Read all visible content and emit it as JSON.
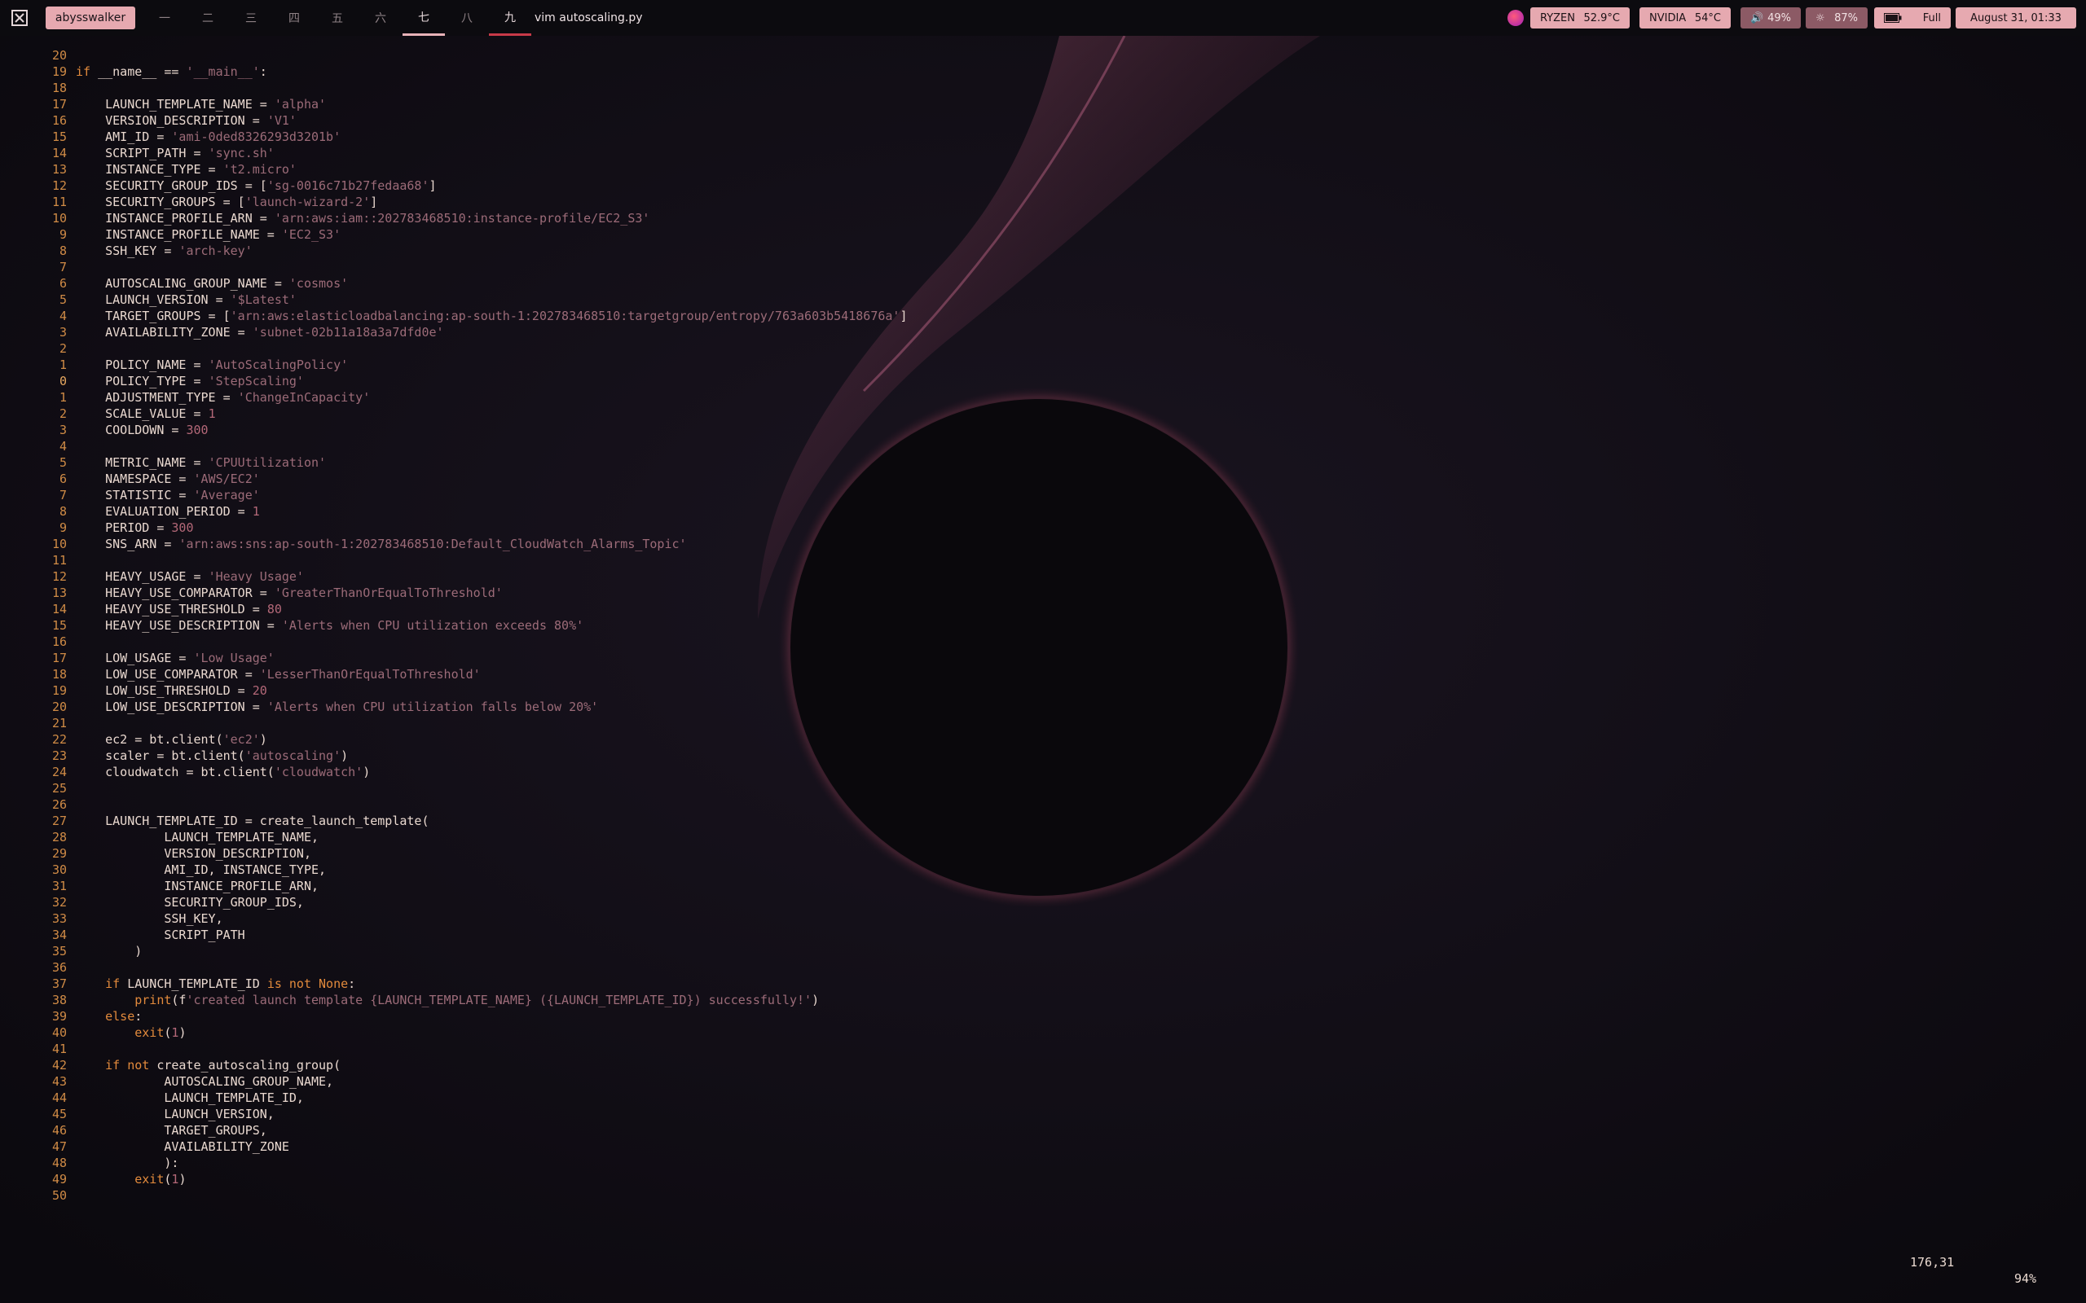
{
  "topbar": {
    "user": "abysswalker",
    "workspaces": [
      {
        "label": "一",
        "state": "normal"
      },
      {
        "label": "二",
        "state": "normal"
      },
      {
        "label": "三",
        "state": "normal"
      },
      {
        "label": "四",
        "state": "normal"
      },
      {
        "label": "五",
        "state": "normal"
      },
      {
        "label": "六",
        "state": "normal"
      },
      {
        "label": "七",
        "state": "active"
      },
      {
        "label": "八",
        "state": "normal"
      },
      {
        "label": "九",
        "state": "urgent"
      }
    ],
    "window_title": "vim autoscaling.py",
    "cpu": {
      "name": "RYZEN",
      "temp": "52.9°C"
    },
    "gpu": {
      "name": "NVIDIA",
      "temp": "54°C"
    },
    "volume": "49%",
    "brightness": "87%",
    "battery": "Full",
    "datetime": "August 31, 01:33",
    "colors": {
      "accent": "#e6a9b0",
      "dim_pill": "#8c5a65",
      "active_underline": "#e8b2b8",
      "urgent_underline": "#c83a48"
    }
  },
  "editor": {
    "lines": [
      {
        "n": "20",
        "t": [
          [
            "plain",
            ""
          ]
        ]
      },
      {
        "n": "19",
        "t": [
          [
            "kw",
            "if"
          ],
          [
            "plain",
            " __name__ == "
          ],
          [
            "str",
            "'__main__'"
          ],
          [
            "plain",
            ":"
          ]
        ]
      },
      {
        "n": "18",
        "t": [
          [
            "plain",
            ""
          ]
        ]
      },
      {
        "n": "17",
        "t": [
          [
            "plain",
            "    LAUNCH_TEMPLATE_NAME = "
          ],
          [
            "str",
            "'alpha'"
          ]
        ]
      },
      {
        "n": "16",
        "t": [
          [
            "plain",
            "    VERSION_DESCRIPTION = "
          ],
          [
            "str",
            "'V1'"
          ]
        ]
      },
      {
        "n": "15",
        "t": [
          [
            "plain",
            "    AMI_ID = "
          ],
          [
            "str",
            "'ami-0ded8326293d3201b'"
          ]
        ]
      },
      {
        "n": "14",
        "t": [
          [
            "plain",
            "    SCRIPT_PATH = "
          ],
          [
            "str",
            "'sync.sh'"
          ]
        ]
      },
      {
        "n": "13",
        "t": [
          [
            "plain",
            "    INSTANCE_TYPE = "
          ],
          [
            "str",
            "'t2.micro'"
          ]
        ]
      },
      {
        "n": "12",
        "t": [
          [
            "plain",
            "    SECURITY_GROUP_IDS = ["
          ],
          [
            "str",
            "'sg-0016c71b27fedaa68'"
          ],
          [
            "plain",
            "]"
          ]
        ]
      },
      {
        "n": "11",
        "t": [
          [
            "plain",
            "    SECURITY_GROUPS = ["
          ],
          [
            "str",
            "'launch-wizard-2'"
          ],
          [
            "plain",
            "]"
          ]
        ]
      },
      {
        "n": "10",
        "t": [
          [
            "plain",
            "    INSTANCE_PROFILE_ARN = "
          ],
          [
            "str",
            "'arn:aws:iam::202783468510:instance-profile/EC2_S3'"
          ]
        ]
      },
      {
        "n": "9",
        "t": [
          [
            "plain",
            "    INSTANCE_PROFILE_NAME = "
          ],
          [
            "str",
            "'EC2_S3'"
          ]
        ]
      },
      {
        "n": "8",
        "t": [
          [
            "plain",
            "    SSH_KEY = "
          ],
          [
            "str",
            "'arch-key'"
          ]
        ]
      },
      {
        "n": "7",
        "t": [
          [
            "plain",
            ""
          ]
        ]
      },
      {
        "n": "6",
        "t": [
          [
            "plain",
            "    AUTOSCALING_GROUP_NAME = "
          ],
          [
            "str",
            "'cosmos'"
          ]
        ]
      },
      {
        "n": "5",
        "t": [
          [
            "plain",
            "    LAUNCH_VERSION = "
          ],
          [
            "str",
            "'$Latest'"
          ]
        ]
      },
      {
        "n": "4",
        "t": [
          [
            "plain",
            "    TARGET_GROUPS = ["
          ],
          [
            "str",
            "'arn:aws:elasticloadbalancing:ap-south-1:202783468510:targetgroup/entropy/763a603b5418676a'"
          ],
          [
            "plain",
            "]"
          ]
        ]
      },
      {
        "n": "3",
        "t": [
          [
            "plain",
            "    AVAILABILITY_ZONE = "
          ],
          [
            "str",
            "'subnet-02b11a18a3a7dfd0e'"
          ]
        ]
      },
      {
        "n": "2",
        "t": [
          [
            "plain",
            ""
          ]
        ]
      },
      {
        "n": "1",
        "t": [
          [
            "plain",
            "    POLICY_NAME = "
          ],
          [
            "str",
            "'AutoScalingPolicy'"
          ]
        ]
      },
      {
        "n": "0",
        "cur": true,
        "t": [
          [
            "plain",
            "    POLICY_TYPE = "
          ],
          [
            "str",
            "'StepScaling'"
          ]
        ]
      },
      {
        "n": "1",
        "t": [
          [
            "plain",
            "    ADJUSTMENT_TYPE = "
          ],
          [
            "str",
            "'ChangeInCapacity'"
          ]
        ]
      },
      {
        "n": "2",
        "t": [
          [
            "plain",
            "    SCALE_VALUE = "
          ],
          [
            "num",
            "1"
          ]
        ]
      },
      {
        "n": "3",
        "t": [
          [
            "plain",
            "    COOLDOWN = "
          ],
          [
            "num",
            "300"
          ]
        ]
      },
      {
        "n": "4",
        "t": [
          [
            "plain",
            ""
          ]
        ]
      },
      {
        "n": "5",
        "t": [
          [
            "plain",
            "    METRIC_NAME = "
          ],
          [
            "str",
            "'CPUUtilization'"
          ]
        ]
      },
      {
        "n": "6",
        "t": [
          [
            "plain",
            "    NAMESPACE = "
          ],
          [
            "str",
            "'AWS/EC2'"
          ]
        ]
      },
      {
        "n": "7",
        "t": [
          [
            "plain",
            "    STATISTIC = "
          ],
          [
            "str",
            "'Average'"
          ]
        ]
      },
      {
        "n": "8",
        "t": [
          [
            "plain",
            "    EVALUATION_PERIOD = "
          ],
          [
            "num",
            "1"
          ]
        ]
      },
      {
        "n": "9",
        "t": [
          [
            "plain",
            "    PERIOD = "
          ],
          [
            "num",
            "300"
          ]
        ]
      },
      {
        "n": "10",
        "t": [
          [
            "plain",
            "    SNS_ARN = "
          ],
          [
            "str",
            "'arn:aws:sns:ap-south-1:202783468510:Default_CloudWatch_Alarms_Topic'"
          ]
        ]
      },
      {
        "n": "11",
        "t": [
          [
            "plain",
            ""
          ]
        ]
      },
      {
        "n": "12",
        "t": [
          [
            "plain",
            "    HEAVY_USAGE = "
          ],
          [
            "str",
            "'Heavy Usage'"
          ]
        ]
      },
      {
        "n": "13",
        "t": [
          [
            "plain",
            "    HEAVY_USE_COMPARATOR = "
          ],
          [
            "str",
            "'GreaterThanOrEqualToThreshold'"
          ]
        ]
      },
      {
        "n": "14",
        "t": [
          [
            "plain",
            "    HEAVY_USE_THRESHOLD = "
          ],
          [
            "num",
            "80"
          ]
        ]
      },
      {
        "n": "15",
        "t": [
          [
            "plain",
            "    HEAVY_USE_DESCRIPTION = "
          ],
          [
            "str",
            "'Alerts when CPU utilization exceeds 80%'"
          ]
        ]
      },
      {
        "n": "16",
        "t": [
          [
            "plain",
            ""
          ]
        ]
      },
      {
        "n": "17",
        "t": [
          [
            "plain",
            "    LOW_USAGE = "
          ],
          [
            "str",
            "'Low Usage'"
          ]
        ]
      },
      {
        "n": "18",
        "t": [
          [
            "plain",
            "    LOW_USE_COMPARATOR = "
          ],
          [
            "str",
            "'LesserThanOrEqualToThreshold'"
          ]
        ]
      },
      {
        "n": "19",
        "t": [
          [
            "plain",
            "    LOW_USE_THRESHOLD = "
          ],
          [
            "num",
            "20"
          ]
        ]
      },
      {
        "n": "20",
        "t": [
          [
            "plain",
            "    LOW_USE_DESCRIPTION = "
          ],
          [
            "str",
            "'Alerts when CPU utilization falls below 20%'"
          ]
        ]
      },
      {
        "n": "21",
        "t": [
          [
            "plain",
            ""
          ]
        ]
      },
      {
        "n": "22",
        "t": [
          [
            "plain",
            "    ec2 = bt.client("
          ],
          [
            "str",
            "'ec2'"
          ],
          [
            "plain",
            ")"
          ]
        ]
      },
      {
        "n": "23",
        "t": [
          [
            "plain",
            "    scaler = bt.client("
          ],
          [
            "str",
            "'autoscaling'"
          ],
          [
            "plain",
            ")"
          ]
        ]
      },
      {
        "n": "24",
        "t": [
          [
            "plain",
            "    cloudwatch = bt.client("
          ],
          [
            "str",
            "'cloudwatch'"
          ],
          [
            "plain",
            ")"
          ]
        ]
      },
      {
        "n": "25",
        "t": [
          [
            "plain",
            ""
          ]
        ]
      },
      {
        "n": "26",
        "t": [
          [
            "plain",
            ""
          ]
        ]
      },
      {
        "n": "27",
        "t": [
          [
            "plain",
            "    LAUNCH_TEMPLATE_ID = create_launch_template("
          ]
        ]
      },
      {
        "n": "28",
        "t": [
          [
            "plain",
            "            LAUNCH_TEMPLATE_NAME,"
          ]
        ]
      },
      {
        "n": "29",
        "t": [
          [
            "plain",
            "            VERSION_DESCRIPTION,"
          ]
        ]
      },
      {
        "n": "30",
        "t": [
          [
            "plain",
            "            AMI_ID, INSTANCE_TYPE,"
          ]
        ]
      },
      {
        "n": "31",
        "t": [
          [
            "plain",
            "            INSTANCE_PROFILE_ARN,"
          ]
        ]
      },
      {
        "n": "32",
        "t": [
          [
            "plain",
            "            SECURITY_GROUP_IDS,"
          ]
        ]
      },
      {
        "n": "33",
        "t": [
          [
            "plain",
            "            SSH_KEY,"
          ]
        ]
      },
      {
        "n": "34",
        "t": [
          [
            "plain",
            "            SCRIPT_PATH"
          ]
        ]
      },
      {
        "n": "35",
        "t": [
          [
            "plain",
            "        )"
          ]
        ]
      },
      {
        "n": "36",
        "t": [
          [
            "plain",
            ""
          ]
        ]
      },
      {
        "n": "37",
        "t": [
          [
            "kw",
            "    if"
          ],
          [
            "plain",
            " LAUNCH_TEMPLATE_ID "
          ],
          [
            "kw",
            "is not"
          ],
          [
            "plain",
            " "
          ],
          [
            "kw",
            "None"
          ],
          [
            "plain",
            ":"
          ]
        ]
      },
      {
        "n": "38",
        "t": [
          [
            "kw",
            "        print"
          ],
          [
            "plain",
            "(f"
          ],
          [
            "str",
            "'created launch template {LAUNCH_TEMPLATE_NAME} ({LAUNCH_TEMPLATE_ID}) successfully!'"
          ],
          [
            "plain",
            ")"
          ]
        ]
      },
      {
        "n": "39",
        "t": [
          [
            "kw",
            "    else"
          ],
          [
            "plain",
            ":"
          ]
        ]
      },
      {
        "n": "40",
        "t": [
          [
            "kw",
            "        exit"
          ],
          [
            "plain",
            "("
          ],
          [
            "num",
            "1"
          ],
          [
            "plain",
            ")"
          ]
        ]
      },
      {
        "n": "41",
        "t": [
          [
            "plain",
            ""
          ]
        ]
      },
      {
        "n": "42",
        "t": [
          [
            "kw",
            "    if not"
          ],
          [
            "plain",
            " create_autoscaling_group("
          ]
        ]
      },
      {
        "n": "43",
        "t": [
          [
            "plain",
            "            AUTOSCALING_GROUP_NAME,"
          ]
        ]
      },
      {
        "n": "44",
        "t": [
          [
            "plain",
            "            LAUNCH_TEMPLATE_ID,"
          ]
        ]
      },
      {
        "n": "45",
        "t": [
          [
            "plain",
            "            LAUNCH_VERSION,"
          ]
        ]
      },
      {
        "n": "46",
        "t": [
          [
            "plain",
            "            TARGET_GROUPS,"
          ]
        ]
      },
      {
        "n": "47",
        "t": [
          [
            "plain",
            "            AVAILABILITY_ZONE"
          ]
        ]
      },
      {
        "n": "48",
        "t": [
          [
            "plain",
            "            ):"
          ]
        ]
      },
      {
        "n": "49",
        "t": [
          [
            "kw",
            "        exit"
          ],
          [
            "plain",
            "("
          ],
          [
            "num",
            "1"
          ],
          [
            "plain",
            ")"
          ]
        ]
      },
      {
        "n": "50",
        "t": [
          [
            "plain",
            ""
          ]
        ]
      }
    ],
    "ruler_position": "176,31",
    "ruler_percent": "94%"
  }
}
